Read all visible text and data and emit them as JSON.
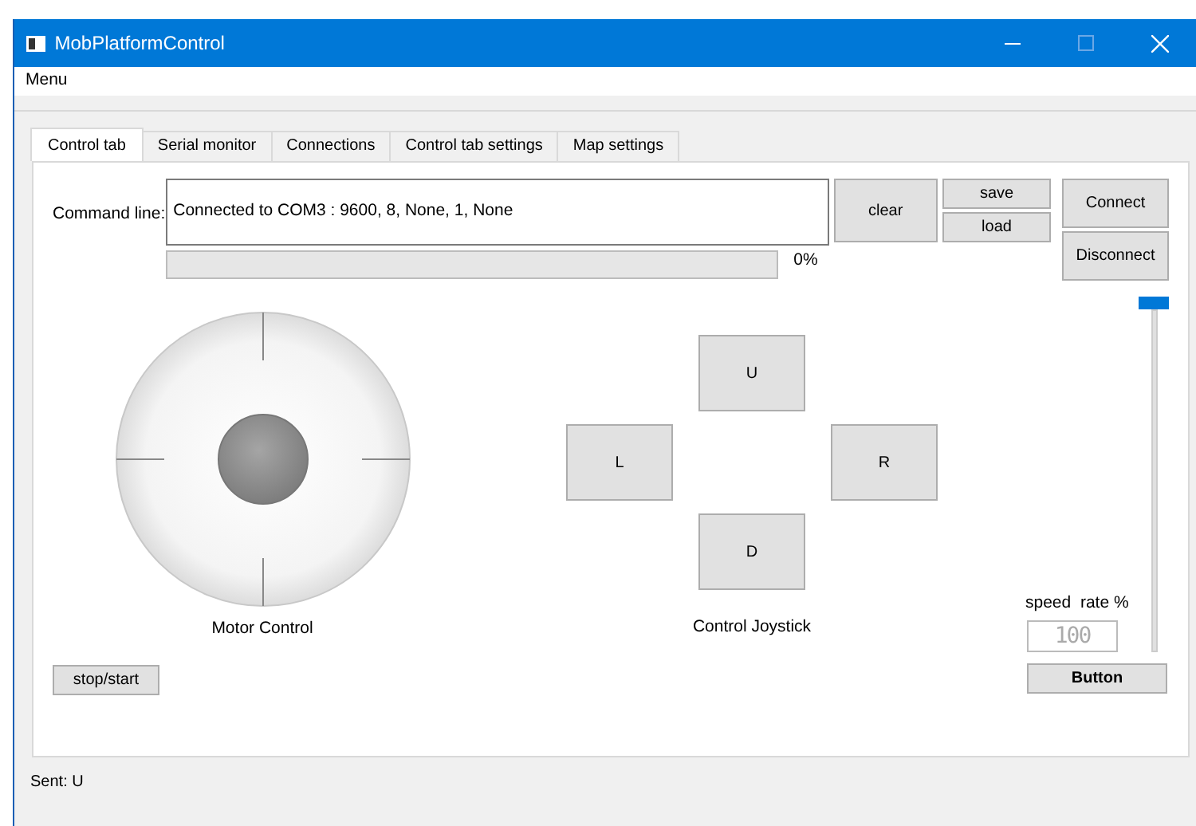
{
  "window": {
    "title": "MobPlatformControl"
  },
  "menu": [
    "Menu"
  ],
  "tabs": [
    {
      "label": "Control tab",
      "selected": true
    },
    {
      "label": "Serial monitor",
      "selected": false
    },
    {
      "label": "Connections",
      "selected": false
    },
    {
      "label": "Control tab settings",
      "selected": false
    },
    {
      "label": "Map settings",
      "selected": false
    }
  ],
  "command_line": {
    "label": "Command line:",
    "value": "Connected to COM3 : 9600, 8, None, 1, None"
  },
  "buttons": {
    "clear": "clear",
    "save": "save",
    "load": "load",
    "connect": "Connect",
    "disconnect": "Disconnect"
  },
  "progress": {
    "reading": "0%"
  },
  "motor_control": {
    "label": "Motor Control",
    "button": "stop/start"
  },
  "joystick": {
    "label": "Control Joystick",
    "keys": [
      "U",
      "L",
      "R",
      "D"
    ]
  },
  "speed": {
    "label": "speed  rate %",
    "display": "100",
    "button": "Button"
  },
  "status_bar": "Sent: U"
}
